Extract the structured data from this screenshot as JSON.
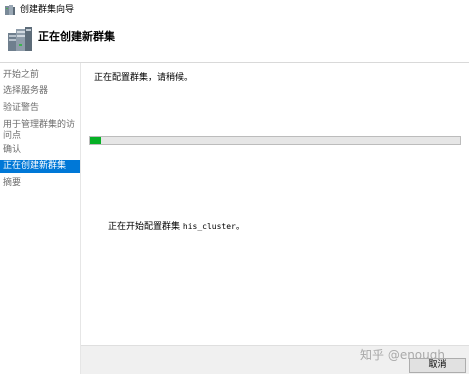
{
  "window": {
    "title": "创建群集向导"
  },
  "header": {
    "title": "正在创建新群集"
  },
  "sidebar": {
    "items": [
      {
        "label": "开始之前",
        "active": false
      },
      {
        "label": "选择服务器",
        "active": false
      },
      {
        "label": "验证警告",
        "active": false
      },
      {
        "label": "用于管理群集的访问点",
        "active": false
      },
      {
        "label": "确认",
        "active": false
      },
      {
        "label": "正在创建新群集",
        "active": true
      },
      {
        "label": "摘要",
        "active": false
      }
    ]
  },
  "main": {
    "status": "正在配置群集，请稍候。",
    "progress_fraction": 0.03,
    "detail_prefix": "正在开始配置群集 ",
    "detail_cluster": "his_cluster",
    "detail_suffix": "。"
  },
  "footer": {
    "watermark": "知乎 @enough",
    "cancel_label": "取消"
  },
  "colors": {
    "accent": "#0078d7",
    "progress": "#06b025"
  },
  "icons": {
    "app": "cluster-wizard-icon",
    "header": "cluster-servers-icon"
  }
}
